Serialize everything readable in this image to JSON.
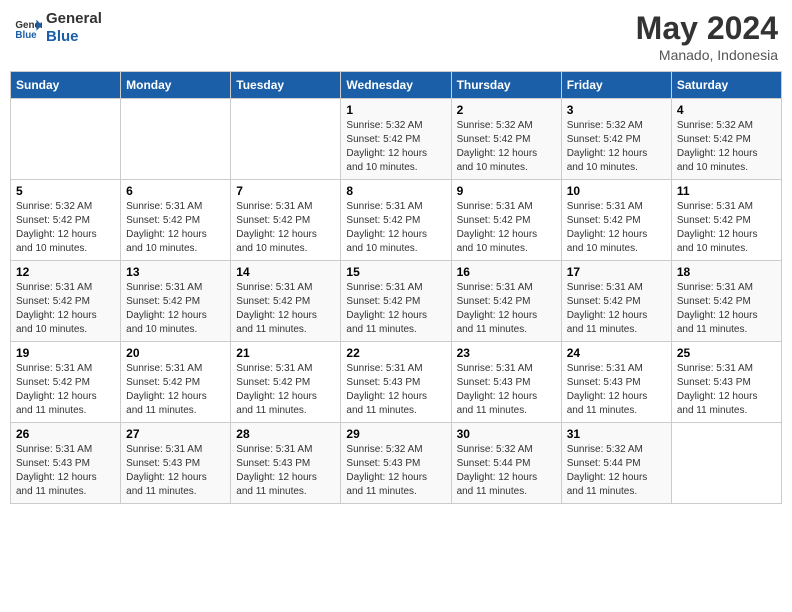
{
  "logo": {
    "line1": "General",
    "line2": "Blue"
  },
  "title": "May 2024",
  "location": "Manado, Indonesia",
  "days_of_week": [
    "Sunday",
    "Monday",
    "Tuesday",
    "Wednesday",
    "Thursday",
    "Friday",
    "Saturday"
  ],
  "weeks": [
    [
      {
        "day": "",
        "info": ""
      },
      {
        "day": "",
        "info": ""
      },
      {
        "day": "",
        "info": ""
      },
      {
        "day": "1",
        "info": "Sunrise: 5:32 AM\nSunset: 5:42 PM\nDaylight: 12 hours\nand 10 minutes."
      },
      {
        "day": "2",
        "info": "Sunrise: 5:32 AM\nSunset: 5:42 PM\nDaylight: 12 hours\nand 10 minutes."
      },
      {
        "day": "3",
        "info": "Sunrise: 5:32 AM\nSunset: 5:42 PM\nDaylight: 12 hours\nand 10 minutes."
      },
      {
        "day": "4",
        "info": "Sunrise: 5:32 AM\nSunset: 5:42 PM\nDaylight: 12 hours\nand 10 minutes."
      }
    ],
    [
      {
        "day": "5",
        "info": "Sunrise: 5:32 AM\nSunset: 5:42 PM\nDaylight: 12 hours\nand 10 minutes."
      },
      {
        "day": "6",
        "info": "Sunrise: 5:31 AM\nSunset: 5:42 PM\nDaylight: 12 hours\nand 10 minutes."
      },
      {
        "day": "7",
        "info": "Sunrise: 5:31 AM\nSunset: 5:42 PM\nDaylight: 12 hours\nand 10 minutes."
      },
      {
        "day": "8",
        "info": "Sunrise: 5:31 AM\nSunset: 5:42 PM\nDaylight: 12 hours\nand 10 minutes."
      },
      {
        "day": "9",
        "info": "Sunrise: 5:31 AM\nSunset: 5:42 PM\nDaylight: 12 hours\nand 10 minutes."
      },
      {
        "day": "10",
        "info": "Sunrise: 5:31 AM\nSunset: 5:42 PM\nDaylight: 12 hours\nand 10 minutes."
      },
      {
        "day": "11",
        "info": "Sunrise: 5:31 AM\nSunset: 5:42 PM\nDaylight: 12 hours\nand 10 minutes."
      }
    ],
    [
      {
        "day": "12",
        "info": "Sunrise: 5:31 AM\nSunset: 5:42 PM\nDaylight: 12 hours\nand 10 minutes."
      },
      {
        "day": "13",
        "info": "Sunrise: 5:31 AM\nSunset: 5:42 PM\nDaylight: 12 hours\nand 10 minutes."
      },
      {
        "day": "14",
        "info": "Sunrise: 5:31 AM\nSunset: 5:42 PM\nDaylight: 12 hours\nand 11 minutes."
      },
      {
        "day": "15",
        "info": "Sunrise: 5:31 AM\nSunset: 5:42 PM\nDaylight: 12 hours\nand 11 minutes."
      },
      {
        "day": "16",
        "info": "Sunrise: 5:31 AM\nSunset: 5:42 PM\nDaylight: 12 hours\nand 11 minutes."
      },
      {
        "day": "17",
        "info": "Sunrise: 5:31 AM\nSunset: 5:42 PM\nDaylight: 12 hours\nand 11 minutes."
      },
      {
        "day": "18",
        "info": "Sunrise: 5:31 AM\nSunset: 5:42 PM\nDaylight: 12 hours\nand 11 minutes."
      }
    ],
    [
      {
        "day": "19",
        "info": "Sunrise: 5:31 AM\nSunset: 5:42 PM\nDaylight: 12 hours\nand 11 minutes."
      },
      {
        "day": "20",
        "info": "Sunrise: 5:31 AM\nSunset: 5:42 PM\nDaylight: 12 hours\nand 11 minutes."
      },
      {
        "day": "21",
        "info": "Sunrise: 5:31 AM\nSunset: 5:42 PM\nDaylight: 12 hours\nand 11 minutes."
      },
      {
        "day": "22",
        "info": "Sunrise: 5:31 AM\nSunset: 5:43 PM\nDaylight: 12 hours\nand 11 minutes."
      },
      {
        "day": "23",
        "info": "Sunrise: 5:31 AM\nSunset: 5:43 PM\nDaylight: 12 hours\nand 11 minutes."
      },
      {
        "day": "24",
        "info": "Sunrise: 5:31 AM\nSunset: 5:43 PM\nDaylight: 12 hours\nand 11 minutes."
      },
      {
        "day": "25",
        "info": "Sunrise: 5:31 AM\nSunset: 5:43 PM\nDaylight: 12 hours\nand 11 minutes."
      }
    ],
    [
      {
        "day": "26",
        "info": "Sunrise: 5:31 AM\nSunset: 5:43 PM\nDaylight: 12 hours\nand 11 minutes."
      },
      {
        "day": "27",
        "info": "Sunrise: 5:31 AM\nSunset: 5:43 PM\nDaylight: 12 hours\nand 11 minutes."
      },
      {
        "day": "28",
        "info": "Sunrise: 5:31 AM\nSunset: 5:43 PM\nDaylight: 12 hours\nand 11 minutes."
      },
      {
        "day": "29",
        "info": "Sunrise: 5:32 AM\nSunset: 5:43 PM\nDaylight: 12 hours\nand 11 minutes."
      },
      {
        "day": "30",
        "info": "Sunrise: 5:32 AM\nSunset: 5:44 PM\nDaylight: 12 hours\nand 11 minutes."
      },
      {
        "day": "31",
        "info": "Sunrise: 5:32 AM\nSunset: 5:44 PM\nDaylight: 12 hours\nand 11 minutes."
      },
      {
        "day": "",
        "info": ""
      }
    ]
  ]
}
